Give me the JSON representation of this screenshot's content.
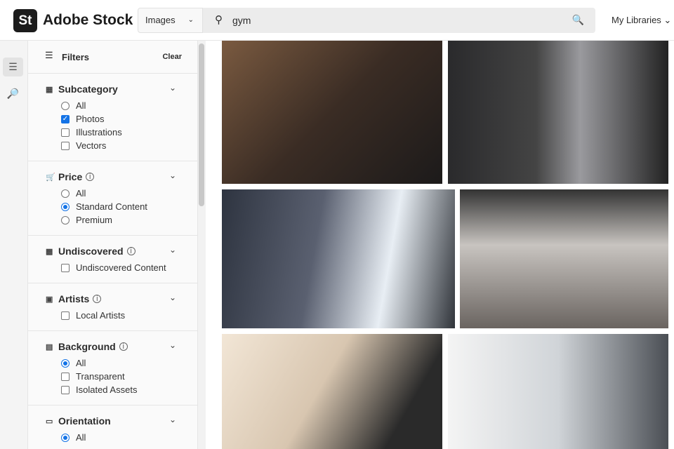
{
  "header": {
    "logo": "St",
    "brand": "Adobe Stock",
    "type_select": "Images",
    "search_value": "gym",
    "my_libraries": "My Libraries"
  },
  "filters": {
    "title": "Filters",
    "clear": "Clear",
    "subcategory": {
      "title": "Subcategory",
      "options": [
        "All",
        "Photos",
        "Illustrations",
        "Vectors"
      ]
    },
    "price": {
      "title": "Price",
      "options": [
        "All",
        "Standard Content",
        "Premium"
      ]
    },
    "undiscovered": {
      "title": "Undiscovered",
      "options": [
        "Undiscovered Content"
      ]
    },
    "artists": {
      "title": "Artists",
      "options": [
        "Local Artists"
      ]
    },
    "background": {
      "title": "Background",
      "options": [
        "All",
        "Transparent",
        "Isolated Assets"
      ]
    },
    "orientation": {
      "title": "Orientation",
      "options": [
        "All"
      ]
    }
  },
  "colors": {
    "accent": "#1473e6"
  }
}
